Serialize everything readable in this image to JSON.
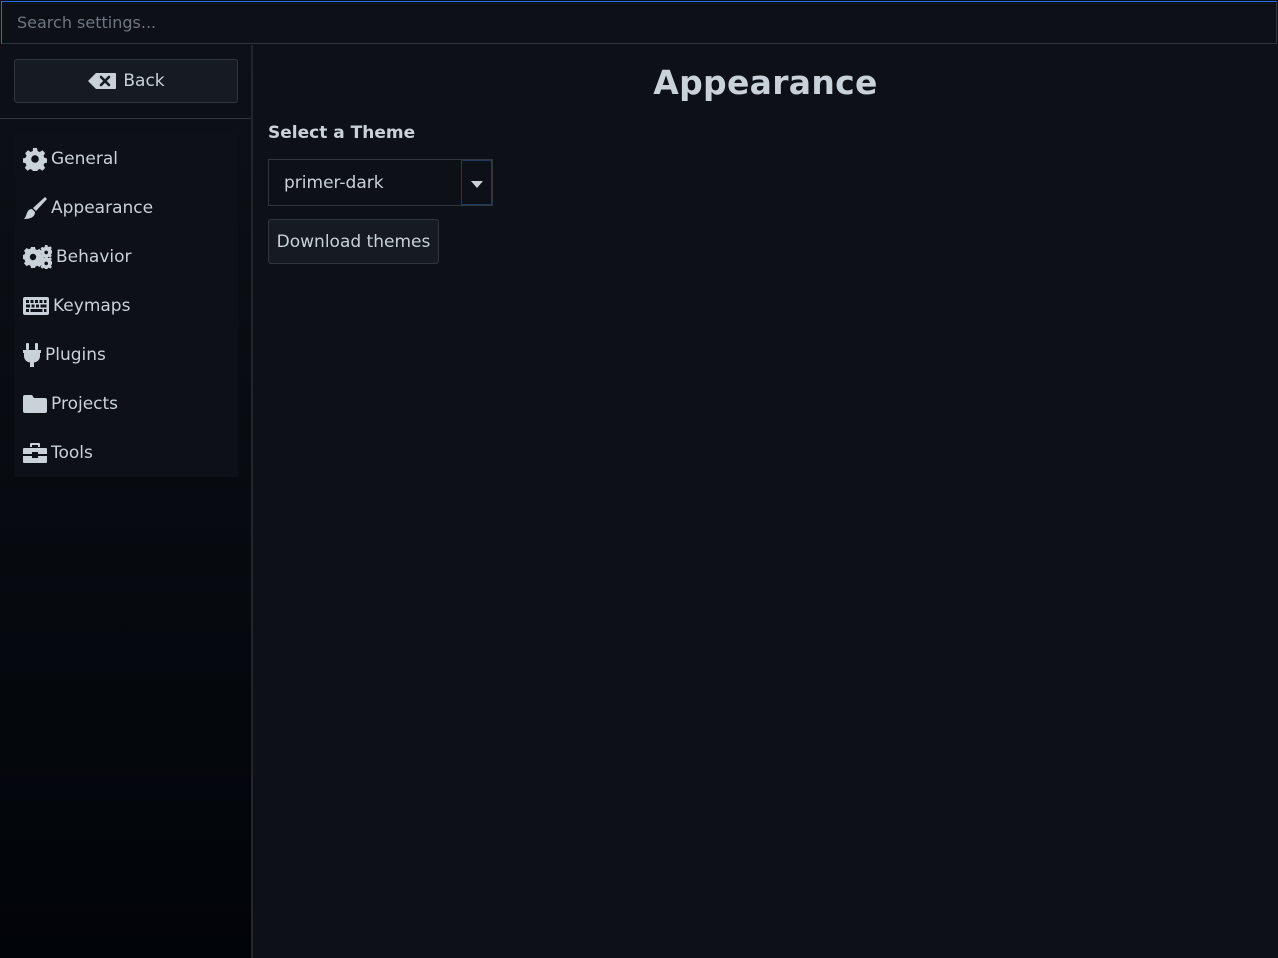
{
  "search": {
    "placeholder": "Search settings...",
    "value": ""
  },
  "sidebar": {
    "back_label": "Back",
    "back_icon": "backspace-icon",
    "items": [
      {
        "label": "General",
        "icon": "gear-icon"
      },
      {
        "label": "Appearance",
        "icon": "paintbrush-icon"
      },
      {
        "label": "Behavior",
        "icon": "gears-icon"
      },
      {
        "label": "Keymaps",
        "icon": "keyboard-icon"
      },
      {
        "label": "Plugins",
        "icon": "plug-icon"
      },
      {
        "label": "Projects",
        "icon": "folder-icon"
      },
      {
        "label": "Tools",
        "icon": "toolbox-icon"
      }
    ]
  },
  "main": {
    "title": "Appearance",
    "theme_section_label": "Select a Theme",
    "theme_select": {
      "selected": "primer-dark",
      "icon": "caret-down-icon"
    },
    "download_label": "Download themes"
  },
  "colors": {
    "background": "#0d1117",
    "sidebar_bottom": "#010409",
    "border": "#30363d",
    "text": "#c9d1d9",
    "focus_accent": "#1f6feb"
  }
}
